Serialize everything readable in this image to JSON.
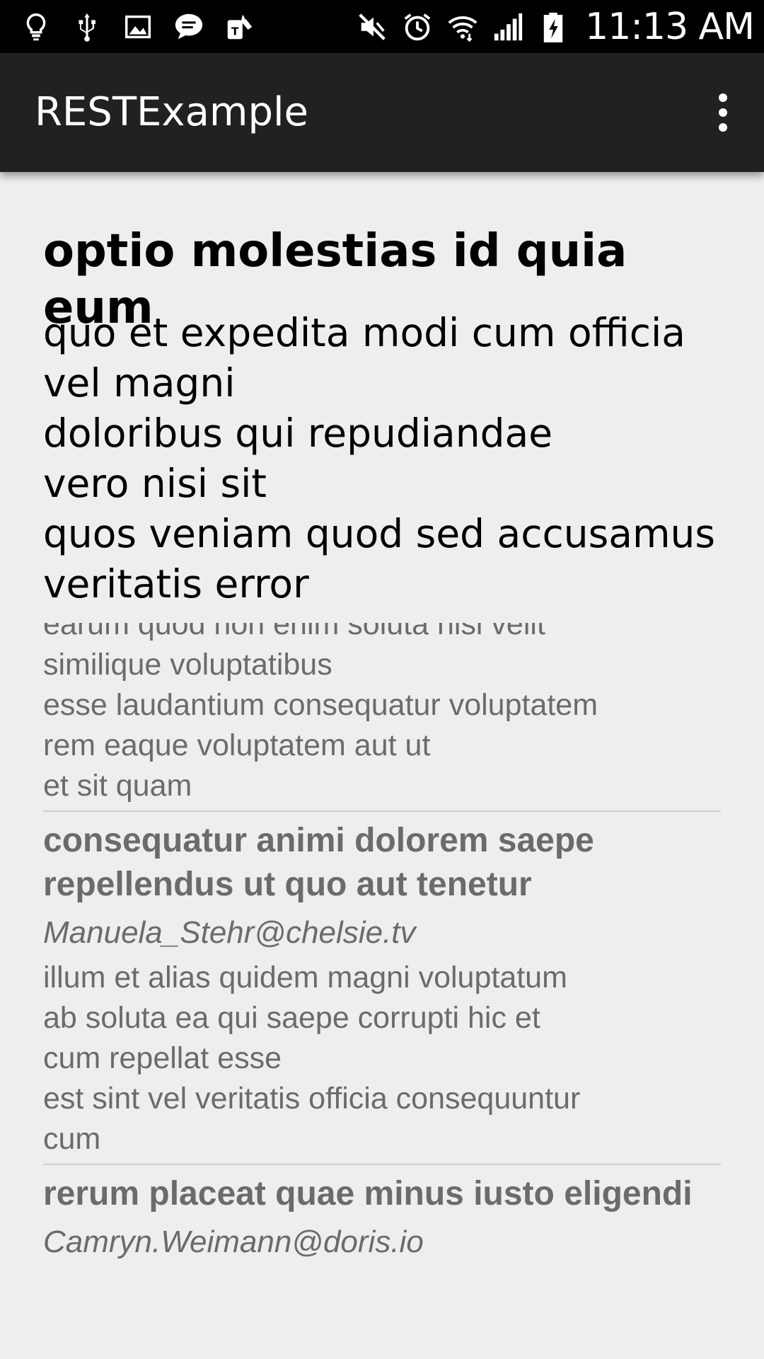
{
  "status_bar": {
    "time": "11:13 AM",
    "left_icons": [
      "lightbulb-icon",
      "usb-icon",
      "image-icon",
      "message-icon",
      "tmobile-icon"
    ],
    "right_icons": [
      "mute-icon",
      "alarm-icon",
      "wifi-icon",
      "signal-icon",
      "battery-charging-icon"
    ]
  },
  "app_bar": {
    "title": "RESTExample",
    "overflow_icon": "overflow-menu-icon"
  },
  "detail": {
    "title": "optio molestias id quia eum",
    "body_lines": [
      "quo et expedita modi cum officia",
      "vel magni",
      "doloribus qui repudiandae",
      "vero nisi sit",
      "quos veniam quod sed accusamus",
      "veritatis error"
    ]
  },
  "list": {
    "partial_item": {
      "body_lines": [
        "earum quod non enim soluta nisi velit",
        "similique voluptatibus",
        "esse laudantium consequatur voluptatem",
        "rem eaque voluptatem aut ut",
        "et sit quam"
      ]
    },
    "items": [
      {
        "title": "consequatur animi dolorem saepe repellendus ut quo aut tenetur",
        "email": "Manuela_Stehr@chelsie.tv",
        "body_lines": [
          "illum et alias quidem magni voluptatum",
          "ab soluta ea qui saepe corrupti hic et",
          "cum repellat esse",
          "est sint vel veritatis officia consequuntur",
          "cum"
        ]
      },
      {
        "title": "rerum placeat quae minus iusto eligendi",
        "email": "Camryn.Weimann@doris.io",
        "body_lines": []
      }
    ]
  }
}
